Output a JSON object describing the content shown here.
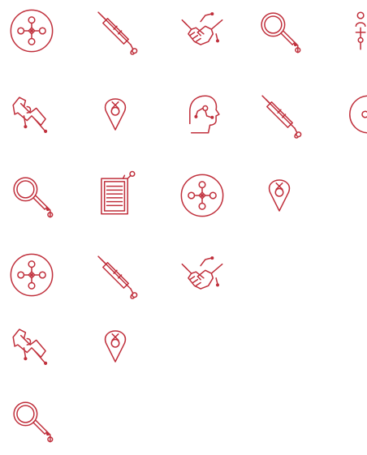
{
  "colors": {
    "background": "#ffffff",
    "icon_stroke": "#c0303c"
  },
  "icon_grid": {
    "rows": [
      [
        "node-network-icon",
        "syringe-icon",
        "handshake-icon",
        "magnifier-icon",
        "user-network-icon"
      ],
      [
        "wrench-icon",
        "location-pin-icon",
        "profile-head-icon",
        "syringe-icon",
        "partial-circle-icon"
      ],
      [
        "magnifier-icon",
        "document-icon",
        "node-network-icon",
        "location-pin-icon"
      ],
      [
        "node-network-icon",
        "syringe-icon",
        "handshake-icon"
      ],
      [
        "wrench-icon",
        "location-pin-icon"
      ],
      [
        "magnifier-icon"
      ]
    ]
  }
}
